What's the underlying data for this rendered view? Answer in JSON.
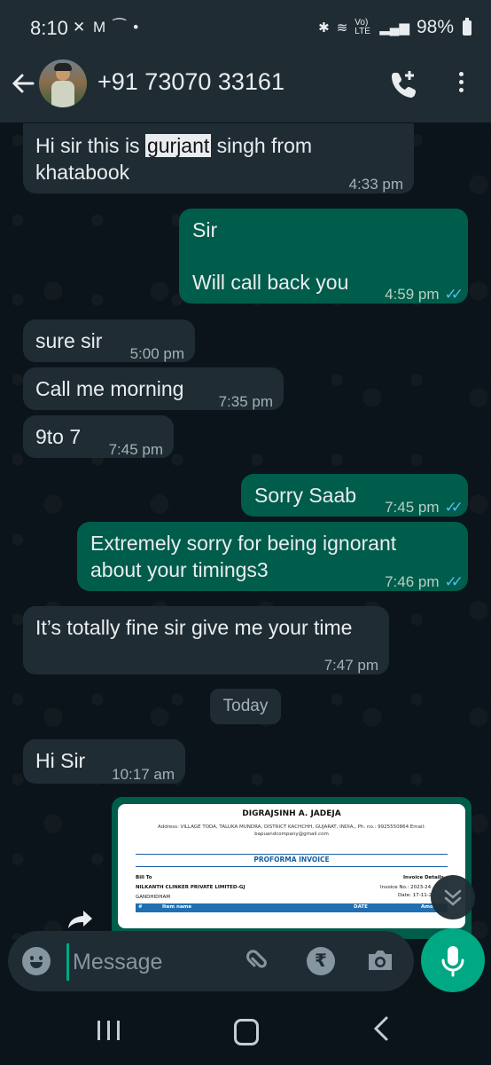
{
  "status_bar": {
    "time": "8:10",
    "left_icons": "✕ M ⁀ •",
    "network": "Vo) LTE",
    "battery": "98%"
  },
  "header": {
    "contact_name": "+91 73070 33161"
  },
  "messages": [
    {
      "dir": "in",
      "text_pre": "Hi sir this is ",
      "text_highlight": "gurjant",
      "text_post": " singh from khatabook",
      "time": "4:33 pm"
    },
    {
      "dir": "out",
      "line1": "Sir",
      "line2": "Will call back you",
      "time": "4:59 pm"
    },
    {
      "dir": "in",
      "text": "sure sir",
      "time": "5:00 pm"
    },
    {
      "dir": "in",
      "text": "Call me morning",
      "time": "7:35 pm"
    },
    {
      "dir": "in",
      "text": "9to 7",
      "time": "7:45 pm"
    },
    {
      "dir": "out",
      "text": "Sorry Saab",
      "time": "7:45 pm"
    },
    {
      "dir": "out",
      "line1": "Extremely sorry for being ignorant",
      "line2": "about your timings3",
      "time": "7:46 pm"
    },
    {
      "dir": "in",
      "text": "It’s totally fine sir give me your time",
      "time": "7:47 pm"
    },
    {
      "dir": "in",
      "text": "Hi Sir",
      "time": "10:17 am"
    }
  ],
  "day_divider": "Today",
  "invoice": {
    "company": "DIGRAJSINH A. JADEJA",
    "address": "Address: VILLAGE TODA, TALUKA MUNDRA, DISTRICT KACHCHH, GUJARAT, INDIA., Ph. no.: 9925550864 Email:",
    "email": "bapuandcompany@gmail.com",
    "title": "PROFORMA INVOICE",
    "bill_to_label": "Bill To",
    "invoice_details_label": "Invoice Details",
    "customer": "NILKANTH CLINKER PRIVATE LIMITED-GJ",
    "city": "GANDHIDHAM",
    "invoice_no": "Invoice No.: 2023-24",
    "date": "Date: 17-11-2",
    "columns": [
      "#",
      "Item name",
      "DATE",
      "Amo"
    ]
  },
  "composer": {
    "placeholder": "Message",
    "rupee_symbol": "₹"
  }
}
